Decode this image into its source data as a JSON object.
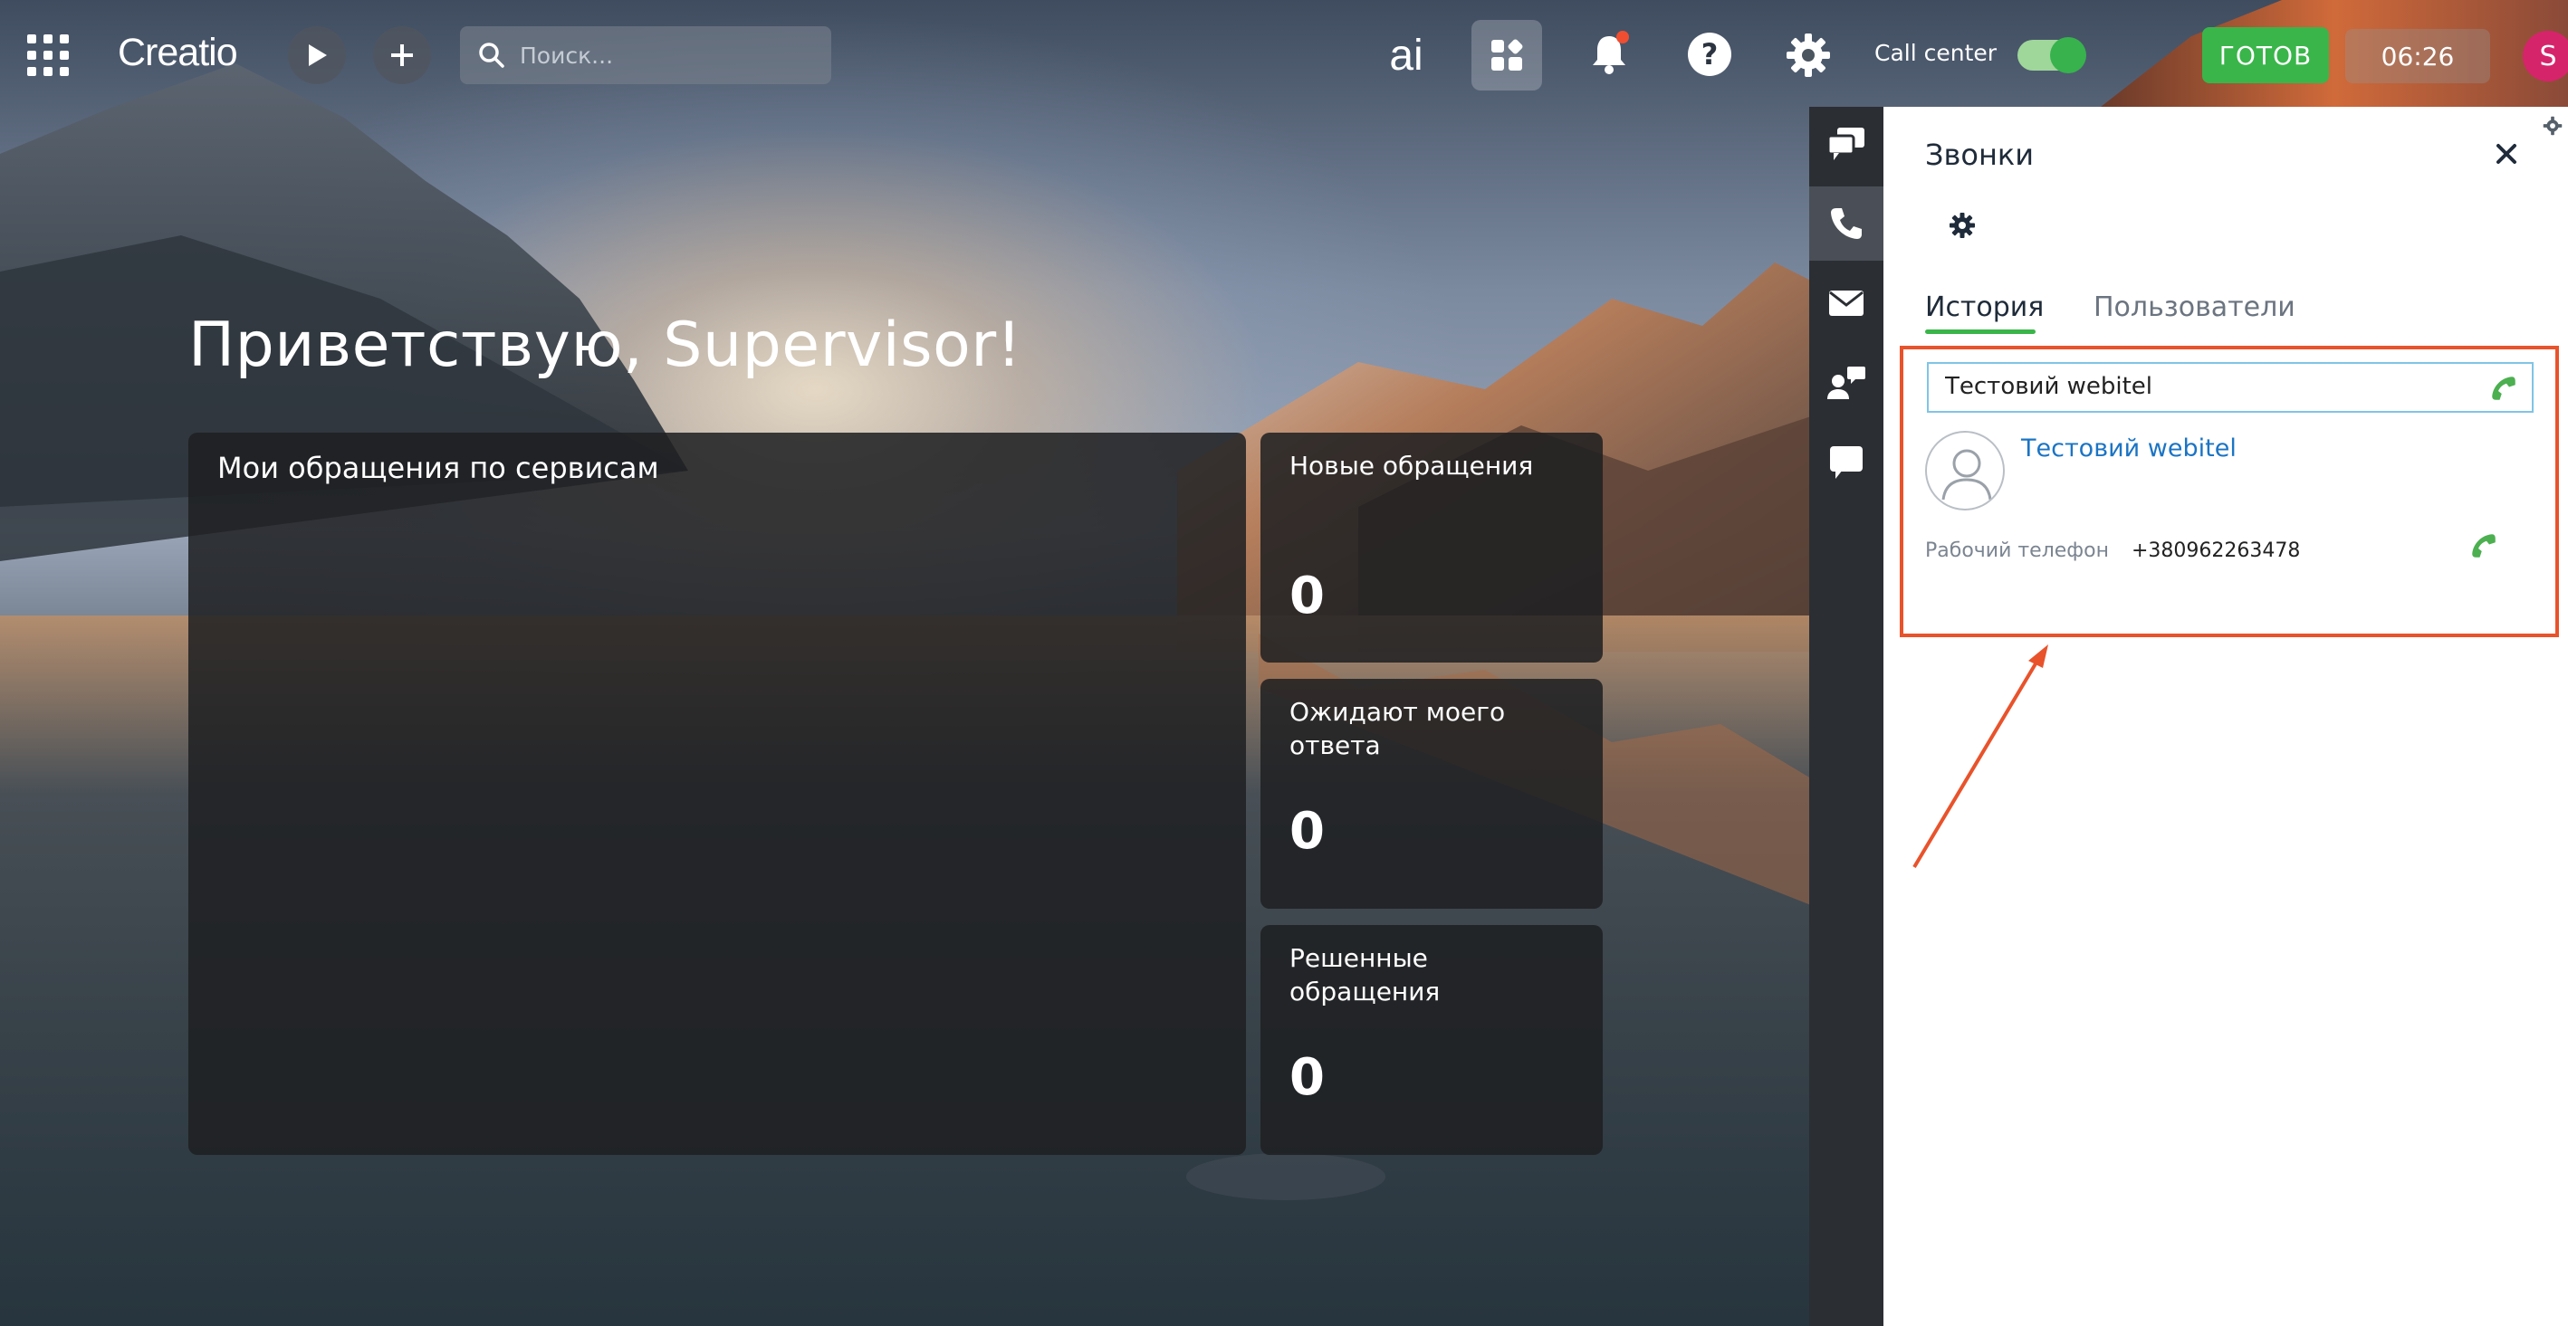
{
  "topbar": {
    "logo": "Creatio",
    "search_placeholder": "Поиск...",
    "ai_label": "ai",
    "call_center_label": "Call center",
    "call_center_on": true,
    "status_label": "ГОТОВ",
    "timer": "06:26",
    "user_initial": "S"
  },
  "main": {
    "greeting": "Приветствую, Supervisor!",
    "service_widget_title": "Мои обращения по сервисам",
    "metrics": [
      {
        "label": "Новые обращения",
        "value": "0"
      },
      {
        "label": "Ожидают моего ответа",
        "value": "0"
      },
      {
        "label": "Решенные обращения",
        "value": "0"
      }
    ]
  },
  "side_strip": {
    "items": [
      "chat-icon",
      "phone-icon",
      "email-icon",
      "contact-chat-icon",
      "message-icon"
    ],
    "active": "phone-icon"
  },
  "calls_panel": {
    "title": "Звонки",
    "tabs": [
      {
        "label": "История",
        "active": true
      },
      {
        "label": "Пользователи",
        "active": false
      }
    ],
    "search_value": "Тестовий webitel",
    "contact": {
      "name": "Тестовий webitel",
      "phone_label": "Рабочий телефон",
      "phone_number": "+380962263478"
    }
  },
  "colors": {
    "accent_green": "#3ab54a",
    "link_blue": "#1b74c4",
    "highlight_red": "#e8532c",
    "notification_dot": "#f04e30",
    "avatar_pink": "#d6246b"
  }
}
